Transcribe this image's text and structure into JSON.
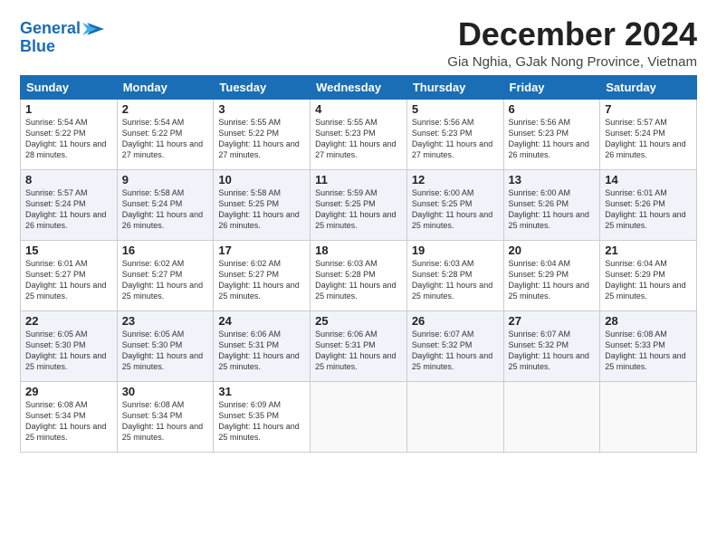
{
  "logo": {
    "line1": "General",
    "line2": "Blue"
  },
  "title": "December 2024",
  "location": "Gia Nghia, GJak Nong Province, Vietnam",
  "days_of_week": [
    "Sunday",
    "Monday",
    "Tuesday",
    "Wednesday",
    "Thursday",
    "Friday",
    "Saturday"
  ],
  "weeks": [
    [
      {
        "day": "1",
        "sunrise": "5:54 AM",
        "sunset": "5:22 PM",
        "daylight": "11 hours and 28 minutes."
      },
      {
        "day": "2",
        "sunrise": "5:54 AM",
        "sunset": "5:22 PM",
        "daylight": "11 hours and 27 minutes."
      },
      {
        "day": "3",
        "sunrise": "5:55 AM",
        "sunset": "5:22 PM",
        "daylight": "11 hours and 27 minutes."
      },
      {
        "day": "4",
        "sunrise": "5:55 AM",
        "sunset": "5:23 PM",
        "daylight": "11 hours and 27 minutes."
      },
      {
        "day": "5",
        "sunrise": "5:56 AM",
        "sunset": "5:23 PM",
        "daylight": "11 hours and 27 minutes."
      },
      {
        "day": "6",
        "sunrise": "5:56 AM",
        "sunset": "5:23 PM",
        "daylight": "11 hours and 26 minutes."
      },
      {
        "day": "7",
        "sunrise": "5:57 AM",
        "sunset": "5:24 PM",
        "daylight": "11 hours and 26 minutes."
      }
    ],
    [
      {
        "day": "8",
        "sunrise": "5:57 AM",
        "sunset": "5:24 PM",
        "daylight": "11 hours and 26 minutes."
      },
      {
        "day": "9",
        "sunrise": "5:58 AM",
        "sunset": "5:24 PM",
        "daylight": "11 hours and 26 minutes."
      },
      {
        "day": "10",
        "sunrise": "5:58 AM",
        "sunset": "5:25 PM",
        "daylight": "11 hours and 26 minutes."
      },
      {
        "day": "11",
        "sunrise": "5:59 AM",
        "sunset": "5:25 PM",
        "daylight": "11 hours and 25 minutes."
      },
      {
        "day": "12",
        "sunrise": "6:00 AM",
        "sunset": "5:25 PM",
        "daylight": "11 hours and 25 minutes."
      },
      {
        "day": "13",
        "sunrise": "6:00 AM",
        "sunset": "5:26 PM",
        "daylight": "11 hours and 25 minutes."
      },
      {
        "day": "14",
        "sunrise": "6:01 AM",
        "sunset": "5:26 PM",
        "daylight": "11 hours and 25 minutes."
      }
    ],
    [
      {
        "day": "15",
        "sunrise": "6:01 AM",
        "sunset": "5:27 PM",
        "daylight": "11 hours and 25 minutes."
      },
      {
        "day": "16",
        "sunrise": "6:02 AM",
        "sunset": "5:27 PM",
        "daylight": "11 hours and 25 minutes."
      },
      {
        "day": "17",
        "sunrise": "6:02 AM",
        "sunset": "5:27 PM",
        "daylight": "11 hours and 25 minutes."
      },
      {
        "day": "18",
        "sunrise": "6:03 AM",
        "sunset": "5:28 PM",
        "daylight": "11 hours and 25 minutes."
      },
      {
        "day": "19",
        "sunrise": "6:03 AM",
        "sunset": "5:28 PM",
        "daylight": "11 hours and 25 minutes."
      },
      {
        "day": "20",
        "sunrise": "6:04 AM",
        "sunset": "5:29 PM",
        "daylight": "11 hours and 25 minutes."
      },
      {
        "day": "21",
        "sunrise": "6:04 AM",
        "sunset": "5:29 PM",
        "daylight": "11 hours and 25 minutes."
      }
    ],
    [
      {
        "day": "22",
        "sunrise": "6:05 AM",
        "sunset": "5:30 PM",
        "daylight": "11 hours and 25 minutes."
      },
      {
        "day": "23",
        "sunrise": "6:05 AM",
        "sunset": "5:30 PM",
        "daylight": "11 hours and 25 minutes."
      },
      {
        "day": "24",
        "sunrise": "6:06 AM",
        "sunset": "5:31 PM",
        "daylight": "11 hours and 25 minutes."
      },
      {
        "day": "25",
        "sunrise": "6:06 AM",
        "sunset": "5:31 PM",
        "daylight": "11 hours and 25 minutes."
      },
      {
        "day": "26",
        "sunrise": "6:07 AM",
        "sunset": "5:32 PM",
        "daylight": "11 hours and 25 minutes."
      },
      {
        "day": "27",
        "sunrise": "6:07 AM",
        "sunset": "5:32 PM",
        "daylight": "11 hours and 25 minutes."
      },
      {
        "day": "28",
        "sunrise": "6:08 AM",
        "sunset": "5:33 PM",
        "daylight": "11 hours and 25 minutes."
      }
    ],
    [
      {
        "day": "29",
        "sunrise": "6:08 AM",
        "sunset": "5:34 PM",
        "daylight": "11 hours and 25 minutes."
      },
      {
        "day": "30",
        "sunrise": "6:08 AM",
        "sunset": "5:34 PM",
        "daylight": "11 hours and 25 minutes."
      },
      {
        "day": "31",
        "sunrise": "6:09 AM",
        "sunset": "5:35 PM",
        "daylight": "11 hours and 25 minutes."
      },
      null,
      null,
      null,
      null
    ]
  ]
}
